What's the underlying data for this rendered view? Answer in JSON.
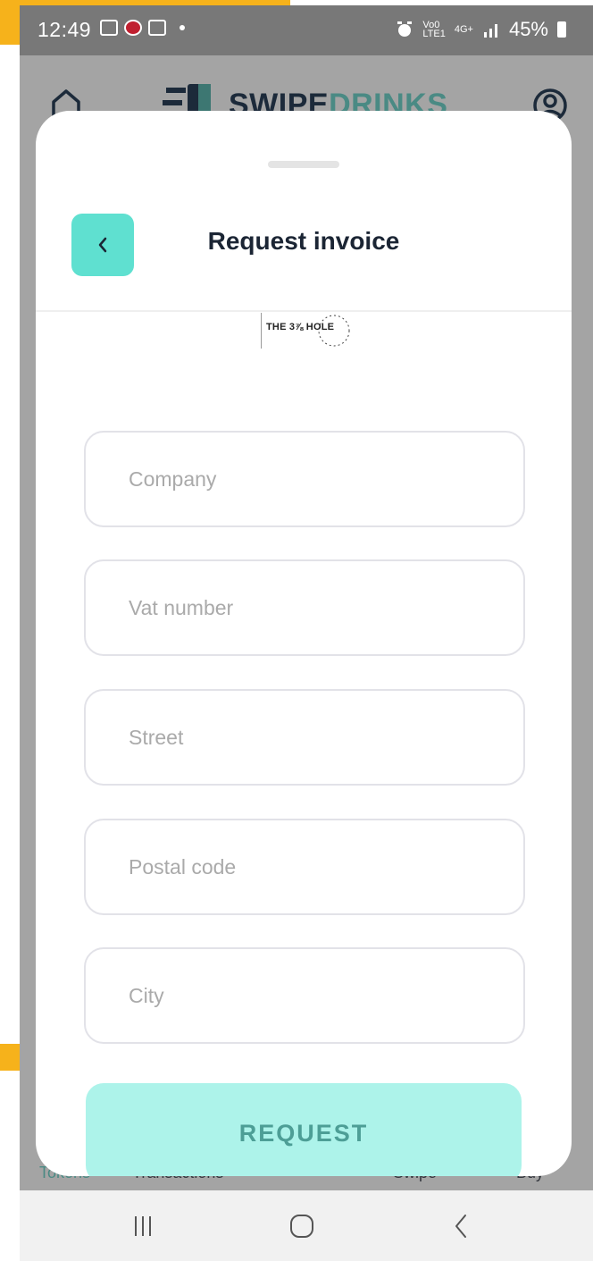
{
  "status_bar": {
    "time": "12:49",
    "battery": "45%",
    "network": "4G+"
  },
  "app_header": {
    "logo_part1": "SWIPE",
    "logo_part2": "DRINKS"
  },
  "sheet": {
    "title": "Request invoice",
    "venue_logo_text": "THE 3⅞ HOLE"
  },
  "form": {
    "fields": [
      {
        "placeholder": "Company",
        "value": ""
      },
      {
        "placeholder": "Vat number",
        "value": ""
      },
      {
        "placeholder": "Street",
        "value": ""
      },
      {
        "placeholder": "Postal code",
        "value": ""
      },
      {
        "placeholder": "City",
        "value": ""
      }
    ],
    "submit_label": "REQUEST"
  },
  "tabs": [
    "Tokens",
    "Transactions",
    "",
    "Swipe",
    "Buy"
  ],
  "colors": {
    "accent": "#5fe0d0",
    "button_disabled": "#adf3ea",
    "title": "#1b2534"
  }
}
